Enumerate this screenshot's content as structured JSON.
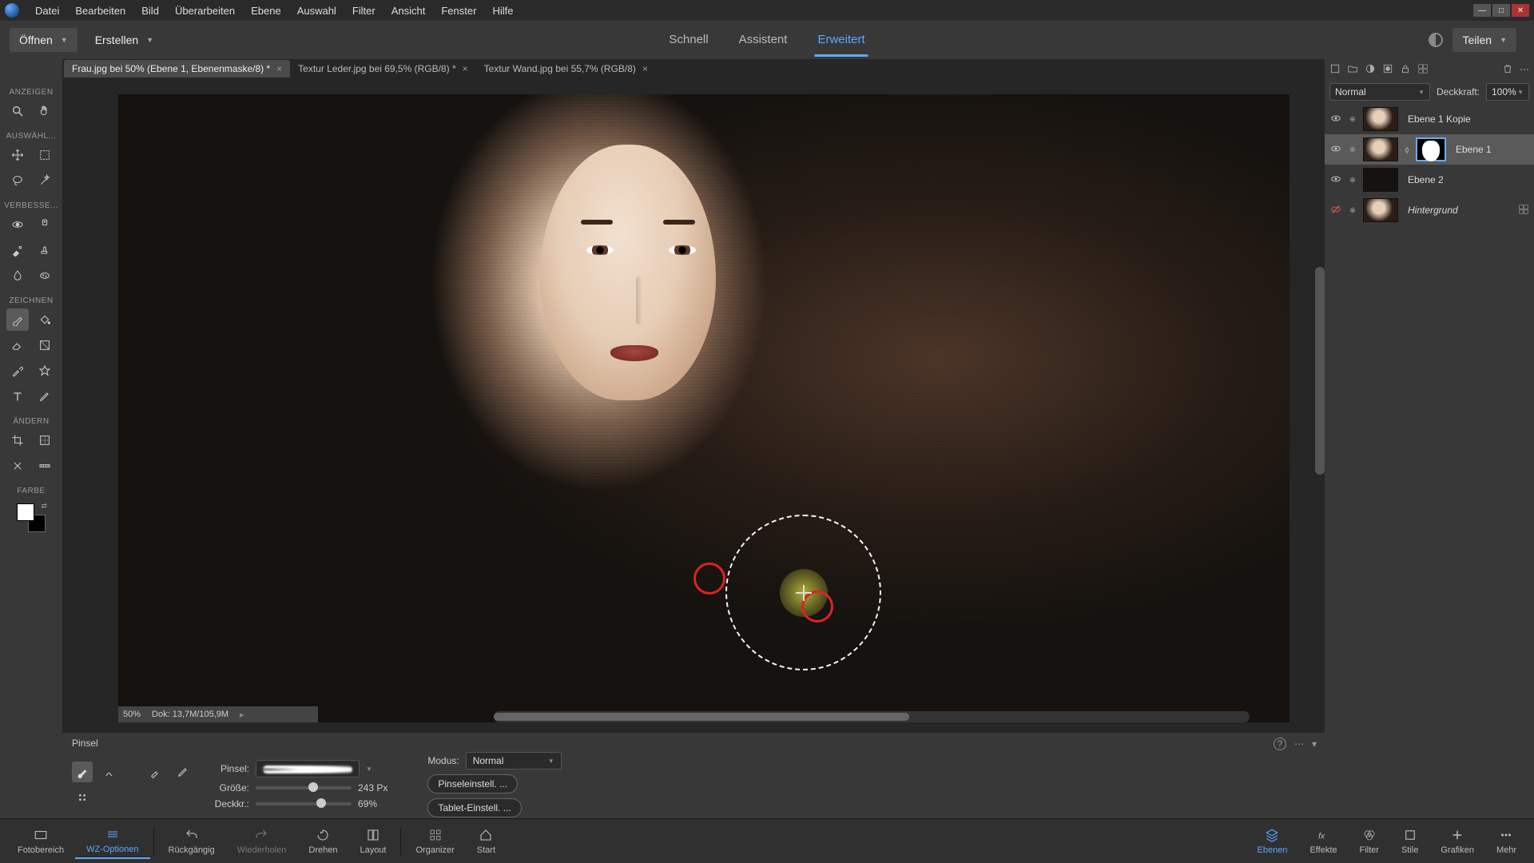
{
  "menu": {
    "file": "Datei",
    "edit": "Bearbeiten",
    "image": "Bild",
    "enhance": "Überarbeiten",
    "layer": "Ebene",
    "select": "Auswahl",
    "filter": "Filter",
    "view": "Ansicht",
    "window": "Fenster",
    "help": "Hilfe"
  },
  "secondbar": {
    "open": "Öffnen",
    "create": "Erstellen",
    "share": "Teilen"
  },
  "modes": {
    "quick": "Schnell",
    "guided": "Assistent",
    "expert": "Erweitert"
  },
  "doctabs": [
    {
      "label": "Frau.jpg bei 50% (Ebene 1, Ebenenmaske/8) *"
    },
    {
      "label": "Textur Leder.jpg bei 69,5% (RGB/8) *"
    },
    {
      "label": "Textur Wand.jpg bei 55,7% (RGB/8)"
    }
  ],
  "toolsections": {
    "view": "ANZEIGEN",
    "select": "AUSWÄHL...",
    "enhance": "VERBESSE...",
    "draw": "ZEICHNEN",
    "modify": "ÄNDERN",
    "color": "FARBE"
  },
  "canvas": {
    "zoom": "50%",
    "docinfo": "Dok: 13,7M/105,9M"
  },
  "layerspanel": {
    "blendLabel": "",
    "blendMode": "Normal",
    "opacityLabel": "Deckkraft:",
    "opacityValue": "100%",
    "layers": [
      {
        "name": "Ebene 1 Kopie"
      },
      {
        "name": "Ebene 1"
      },
      {
        "name": "Ebene 2"
      },
      {
        "name": "Hintergrund"
      }
    ]
  },
  "options": {
    "toolname": "Pinsel",
    "brushLabel": "Pinsel:",
    "sizeLabel": "Größe:",
    "sizeValue": "243 Px",
    "sizePercent": 55,
    "opacityLabel": "Deckkr.:",
    "opacityValue": "69%",
    "opacityPercent": 63,
    "modeLabel": "Modus:",
    "modeValue": "Normal",
    "brushSettings": "Pinseleinstell. ...",
    "tabletSettings": "Tablet-Einstell. ..."
  },
  "bottombar": {
    "photobin": "Fotobereich",
    "tooloptions": "WZ-Optionen",
    "undo": "Rückgängig",
    "redo": "Wiederholen",
    "rotate": "Drehen",
    "layout": "Layout",
    "organizer": "Organizer",
    "home": "Start",
    "layers": "Ebenen",
    "effects": "Effekte",
    "filters": "Filter",
    "styles": "Stile",
    "graphics": "Grafiken",
    "more": "Mehr"
  }
}
